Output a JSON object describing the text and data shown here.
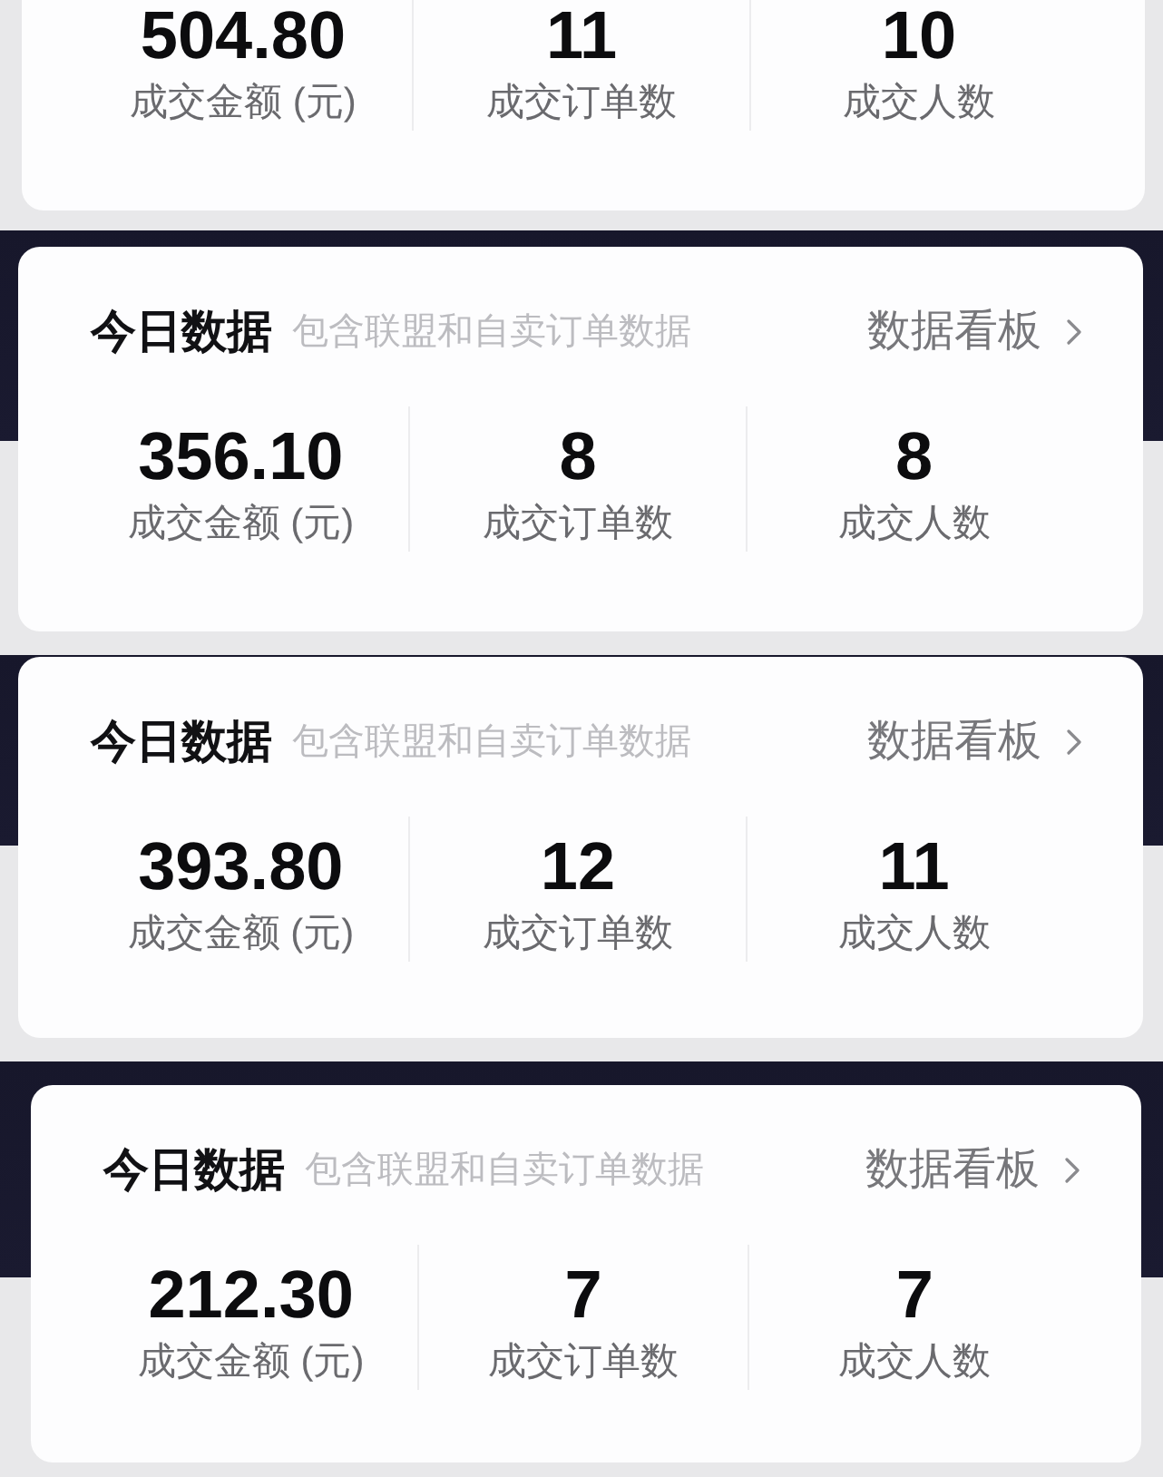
{
  "screenshots": [
    {
      "stats": [
        {
          "value": "504.80",
          "label": "成交金额 (元)"
        },
        {
          "value": "11",
          "label": "成交订单数"
        },
        {
          "value": "10",
          "label": "成交人数"
        }
      ]
    },
    {
      "header": {
        "title": "今日数据",
        "subtitle": "包含联盟和自卖订单数据",
        "link": "数据看板"
      },
      "stats": [
        {
          "value": "356.10",
          "label": "成交金额 (元)"
        },
        {
          "value": "8",
          "label": "成交订单数"
        },
        {
          "value": "8",
          "label": "成交人数"
        }
      ]
    },
    {
      "header": {
        "title": "今日数据",
        "subtitle": "包含联盟和自卖订单数据",
        "link": "数据看板"
      },
      "stats": [
        {
          "value": "393.80",
          "label": "成交金额 (元)"
        },
        {
          "value": "12",
          "label": "成交订单数"
        },
        {
          "value": "11",
          "label": "成交人数"
        }
      ]
    },
    {
      "header": {
        "title": "今日数据",
        "subtitle": "包含联盟和自卖订单数据",
        "link": "数据看板"
      },
      "stats": [
        {
          "value": "212.30",
          "label": "成交金额 (元)"
        },
        {
          "value": "7",
          "label": "成交订单数"
        },
        {
          "value": "7",
          "label": "成交人数"
        }
      ]
    }
  ]
}
